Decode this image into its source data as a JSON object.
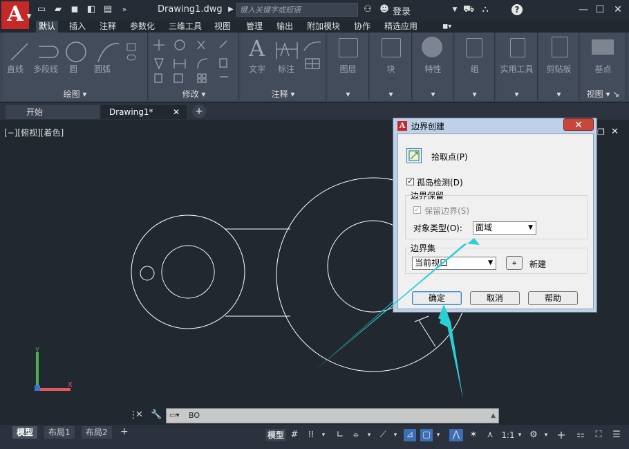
{
  "app": {
    "logo_letter": "A",
    "document_title": "Drawing1.dwg",
    "search_placeholder": "键入关键字或短语",
    "login": "登录",
    "accent": "#c62828"
  },
  "ribbon_tabs": [
    "默认",
    "插入",
    "注释",
    "参数化",
    "三维工具",
    "视图",
    "管理",
    "输出",
    "附加模块",
    "协作",
    "精选应用"
  ],
  "ribbon": {
    "draw": {
      "title": "绘图",
      "tools": [
        "直线",
        "多段线",
        "圆",
        "圆弧"
      ]
    },
    "modify": {
      "title": "修改"
    },
    "annotation": {
      "title": "注释",
      "tools": [
        "文字",
        "标注"
      ]
    },
    "layers": "图层",
    "block": "块",
    "properties": "特性",
    "group": "组",
    "utilities": "实用工具",
    "clipboard": "剪贴板",
    "base": "基点",
    "view": "视图"
  },
  "doc_tabs": {
    "start": "开始",
    "drawing": "Drawing1*"
  },
  "viewport_label": "[−][俯视][着色]",
  "command_line": {
    "value": "BO"
  },
  "layout_tabs": [
    "模型",
    "布局1",
    "布局2"
  ],
  "status": {
    "model": "模型",
    "scale": "1:1"
  },
  "dialog": {
    "title": "边界创建",
    "pick_points": "拾取点",
    "pick_points_key": "(P)",
    "island_detection": "孤岛检测",
    "island_detection_key": "(D)",
    "island_checked": "✓",
    "retain_group": "边界保留",
    "retain_boundaries": "保留边界",
    "retain_boundaries_key": "(S)",
    "object_type_label": "对象类型",
    "object_type_key": "(O):",
    "object_type_value": "面域",
    "boundary_set_group": "边界集",
    "boundary_set_value": "当前视口",
    "new_button": "新建",
    "ok": "确定",
    "cancel": "取消",
    "help": "帮助"
  }
}
